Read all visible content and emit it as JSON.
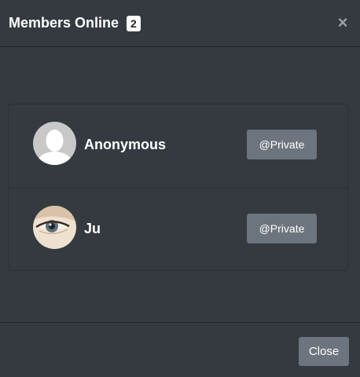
{
  "header": {
    "title": "Members Online",
    "count": "2",
    "close_icon": "close-icon"
  },
  "members": [
    {
      "name": "Anonymous",
      "avatar": "default-avatar",
      "action_label": "@Private"
    },
    {
      "name": "Ju",
      "avatar": "eye-photo-avatar",
      "action_label": "@Private"
    }
  ],
  "footer": {
    "close_label": "Close"
  },
  "colors": {
    "background": "#343a40",
    "button": "#6c757d",
    "border": "#212529"
  }
}
